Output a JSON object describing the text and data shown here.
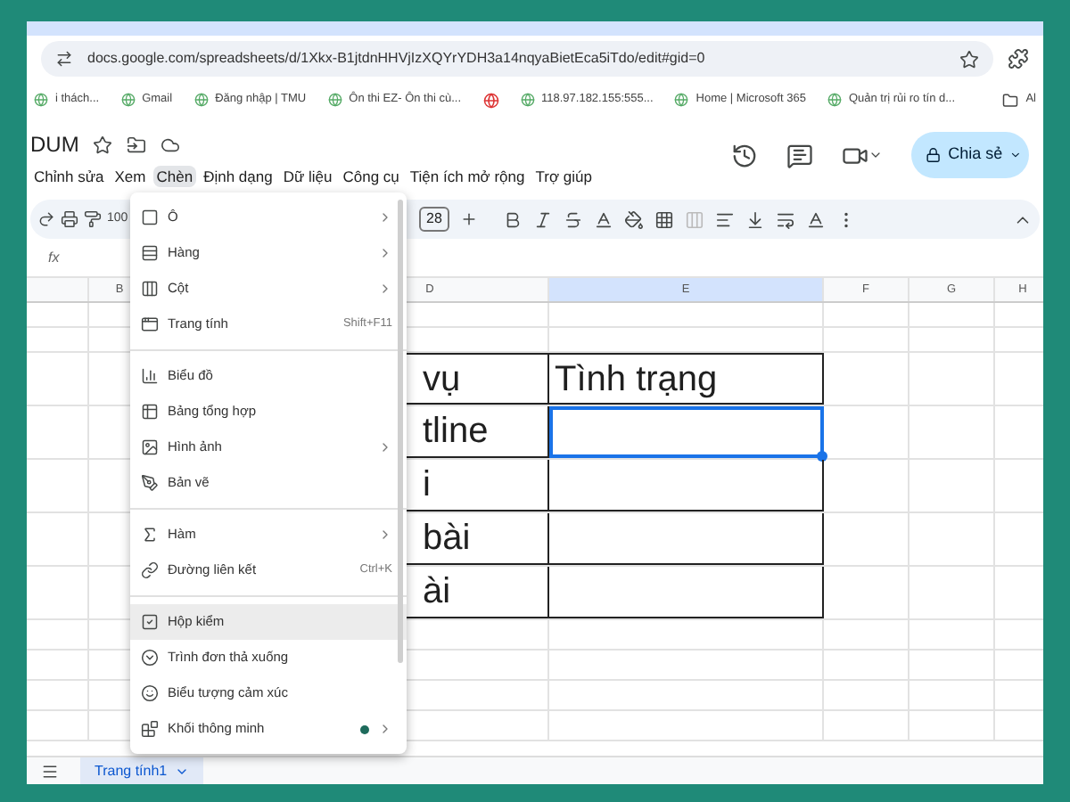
{
  "browser": {
    "url": "docs.google.com/spreadsheets/d/1Xkx-B1jtdnHHVjIzXQYrYDH3a14nqyaBietEca5iTdo/edit#gid=0",
    "bookmarks": [
      {
        "kind": "link",
        "label": "i thách..."
      },
      {
        "kind": "link",
        "label": "Gmail"
      },
      {
        "kind": "link",
        "label": "Đăng nhập | TMU"
      },
      {
        "kind": "link",
        "label": "Ôn thi EZ- Ôn thi cù..."
      },
      {
        "kind": "icon"
      },
      {
        "kind": "link",
        "label": "118.97.182.155:555..."
      },
      {
        "kind": "link",
        "label": "Home | Microsoft 365"
      },
      {
        "kind": "link",
        "label": "Quản trị rủi ro tín d..."
      }
    ],
    "bookmarks_folder": "Al"
  },
  "doc": {
    "title": "DUM",
    "share_label": "Chia sẻ"
  },
  "menubar": [
    {
      "label": "Chỉnh sửa",
      "selected": false
    },
    {
      "label": "Xem",
      "selected": false
    },
    {
      "label": "Chèn",
      "selected": true
    },
    {
      "label": "Định dạng",
      "selected": false
    },
    {
      "label": "Dữ liệu",
      "selected": false
    },
    {
      "label": "Công cụ",
      "selected": false
    },
    {
      "label": "Tiện ích mở rộng",
      "selected": false
    },
    {
      "label": "Trợ giúp",
      "selected": false
    }
  ],
  "toolbar": {
    "zoom": "100",
    "font_size": "28"
  },
  "formula_bar": {
    "label": "fx"
  },
  "columns": [
    "B",
    "D",
    "E",
    "F",
    "G",
    "H"
  ],
  "table": {
    "rows": [
      {
        "col_d": "vụ",
        "col_e": "Tình trạng",
        "selected": false
      },
      {
        "col_d": "tline",
        "selected": true
      },
      {
        "col_d": "i",
        "selected": false
      },
      {
        "col_d": "bài",
        "selected": false
      },
      {
        "col_d": "ài",
        "selected": false
      }
    ]
  },
  "insert_menu": {
    "sections": [
      {
        "items": [
          {
            "label": "Ô",
            "submenu": true,
            "selected": false
          },
          {
            "label": "Hàng",
            "submenu": true,
            "selected": false
          },
          {
            "label": "Cột",
            "submenu": true,
            "selected": false
          },
          {
            "label": "Trang tính",
            "shortcut": "Shift+F11",
            "submenu": false,
            "selected": false
          }
        ]
      },
      {
        "items": [
          {
            "label": "Biểu đồ",
            "submenu": false,
            "selected": false
          },
          {
            "label": "Bảng tổng hợp",
            "submenu": false,
            "selected": false
          },
          {
            "label": "Hình ảnh",
            "submenu": true,
            "selected": false
          },
          {
            "label": "Bản vẽ",
            "submenu": false,
            "selected": false
          }
        ]
      },
      {
        "items": [
          {
            "label": "Hàm",
            "submenu": true,
            "selected": false
          },
          {
            "label": "Đường liên kết",
            "shortcut": "Ctrl+K",
            "submenu": false,
            "selected": false
          }
        ]
      },
      {
        "items": [
          {
            "label": "Hộp kiểm",
            "submenu": false,
            "selected": true
          },
          {
            "label": "Trình đơn thả xuống",
            "submenu": false,
            "selected": false
          },
          {
            "label": "Biểu tượng cảm xúc",
            "submenu": false,
            "selected": false
          },
          {
            "label": "Khối thông minh",
            "submenu": true,
            "new_dot": true,
            "selected": false
          }
        ]
      }
    ]
  },
  "sheet_tabs": [
    {
      "label": "Trang tính1",
      "selected": true
    }
  ]
}
